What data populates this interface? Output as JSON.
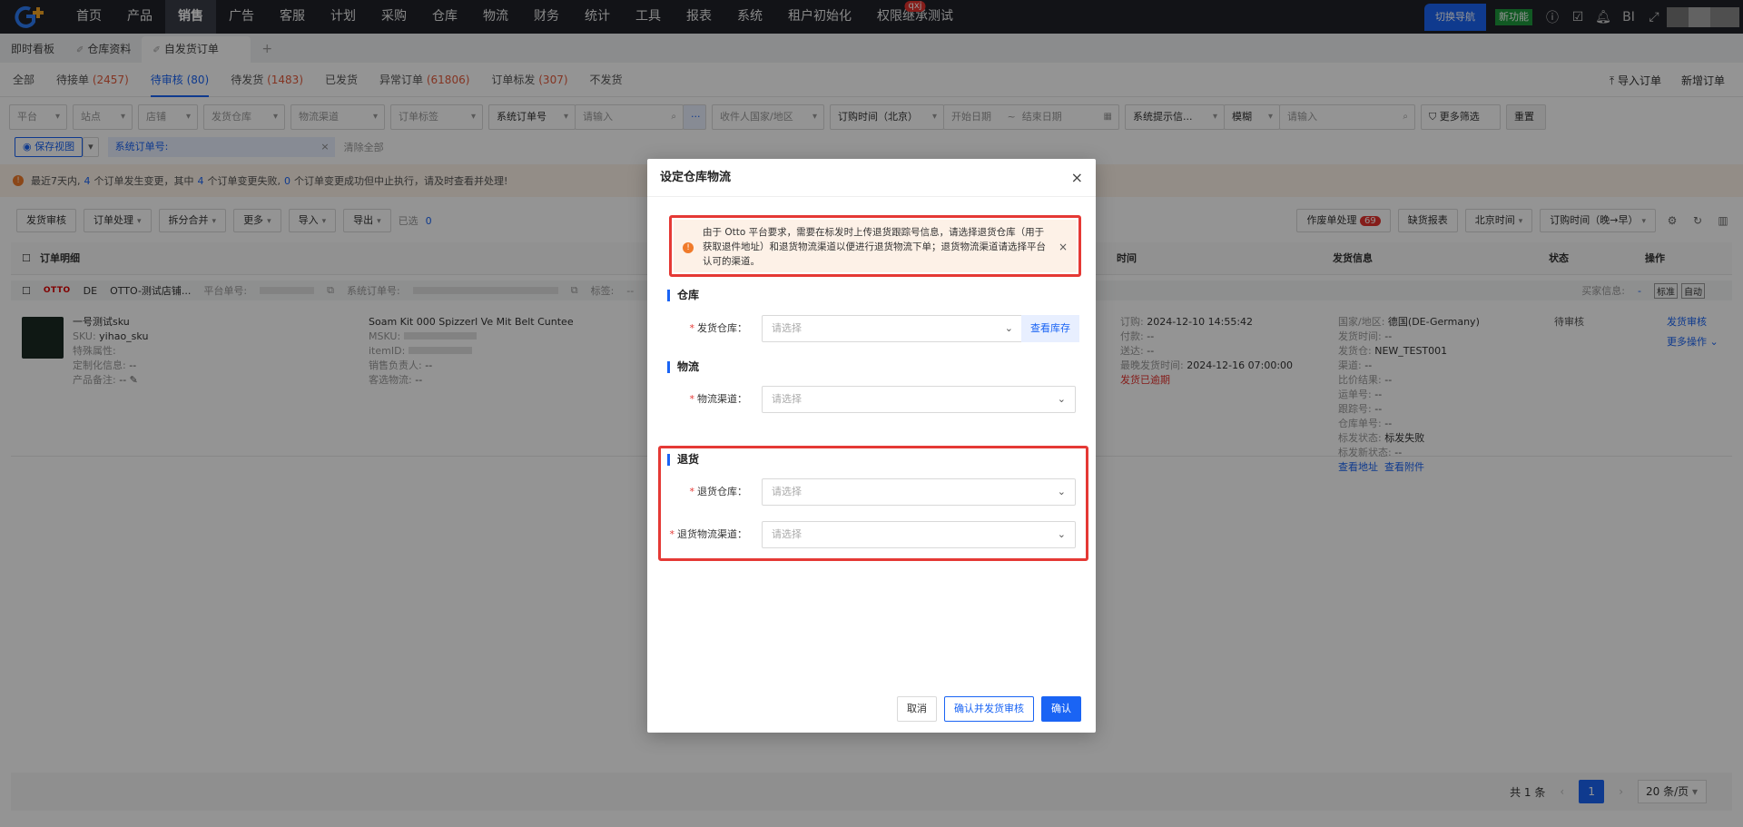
{
  "nav": {
    "logo": "G",
    "items": [
      "首页",
      "产品",
      "销售",
      "广告",
      "客服",
      "计划",
      "采购",
      "仓库",
      "物流",
      "财务",
      "统计",
      "工具",
      "报表",
      "系统",
      "租户初始化",
      "权限继承测试"
    ],
    "active": "销售",
    "badge": "qxj",
    "switch_nav": "切换导航",
    "new_func": "新功能",
    "bi": "BI"
  },
  "tabs": {
    "dashboard": "即时看板",
    "warehouse": "仓库资料",
    "current": "自发货订单",
    "add": "+"
  },
  "status_tabs": [
    {
      "label": "全部",
      "count": ""
    },
    {
      "label": "待接单",
      "count": "(2457)"
    },
    {
      "label": "待审核",
      "count": "(80)"
    },
    {
      "label": "待发货",
      "count": "(1483)"
    },
    {
      "label": "已发货",
      "count": ""
    },
    {
      "label": "异常订单",
      "count": "(61806)"
    },
    {
      "label": "订单标发",
      "count": "(307)"
    },
    {
      "label": "不发货",
      "count": ""
    }
  ],
  "top_actions": {
    "import": "导入订单",
    "new": "新增订单"
  },
  "filters": {
    "platform": "平台",
    "site": "站点",
    "store": "店铺",
    "ship_wh": "发货仓库",
    "channel": "物流渠道",
    "order_tag": "订单标签",
    "sys_order": "系统订单号",
    "input_ph": "请输入",
    "receiver_country": "收件人国家/地区",
    "order_time": "订购时间（北京）",
    "start_date": "开始日期",
    "date_sep": "~",
    "end_date": "结束日期",
    "sys_hint": "系统提示信...",
    "fuzzy": "模糊",
    "input_ph2": "请输入",
    "more_filter": "更多筛选",
    "reset": "重置"
  },
  "view_row": {
    "save_view": "保存视图",
    "chip": "系统订单号:",
    "clear_all": "清除全部"
  },
  "notice": {
    "p1": "最近7天内,",
    "n1": "4",
    "p2": "个订单发生变更，其中",
    "n2": "4",
    "p3": "个订单变更失败,",
    "n3": "0",
    "p4": "个订单变更成功但中止执行，请及时查看并处理!"
  },
  "toolbar": {
    "ship_review": "发货审核",
    "order_proc": "订单处理",
    "split_merge": "拆分合并",
    "more": "更多",
    "import": "导入",
    "export": "导出",
    "selected": "已选",
    "selected_count": "0",
    "void_proc": "作废单处理",
    "void_count": "69",
    "shortage": "缺货报表",
    "beijing": "北京时间",
    "sort": "订购时间（晚→早）"
  },
  "table": {
    "h_detail": "订单明细",
    "h_time": "时间",
    "h_ship": "发货信息",
    "h_status": "状态",
    "h_ops": "操作"
  },
  "group": {
    "platform_logo": "OTTO",
    "site": "DE",
    "store": "OTTO-测试店铺...",
    "platform_no": "平台单号:",
    "sys_no": "系统订单号:",
    "tag": "标签:",
    "tag_val": "--",
    "buyer": "买家信息:",
    "buyer_val": "-",
    "mark_flag": "标准",
    "mark_auto": "自动"
  },
  "row": {
    "name": "一号测试sku",
    "sku_l": "SKU:",
    "sku": "yihao_sku",
    "attr_l": "特殊属性:",
    "custom_l": "定制化信息:",
    "custom": "--",
    "remark_l": "产品备注:",
    "remark": "--",
    "title": "Soam Kit 000 Spizzerl Ve Mit Belt Cuntee",
    "msku_l": "MSKU:",
    "itemid_l": "itemID:",
    "sales_l": "销售负责人:",
    "sales": "--",
    "cust_l": "客选物流:",
    "cust": "--",
    "order_l": "订购:",
    "order_time": "2024-12-10 14:55:42",
    "pay_l": "付款:",
    "pay": "--",
    "deliver_l": "送达:",
    "deliver": "--",
    "latest_l": "最晚发货时间:",
    "latest": "2024-12-16 07:00:00",
    "overdue": "发货已逾期",
    "country_l": "国家/地区:",
    "country": "德国(DE-Germany)",
    "ship_time_l": "发货时间:",
    "ship_time": "--",
    "ship_wh_l": "发货仓:",
    "ship_wh": "NEW_TEST001",
    "channel_l": "渠道:",
    "channel": "--",
    "compare_l": "比价结果:",
    "compare": "--",
    "waybill_l": "运单号:",
    "waybill": "--",
    "tracking_l": "跟踪号:",
    "tracking": "--",
    "wh_order_l": "仓库单号:",
    "wh_order": "--",
    "mark_status_l": "标发状态:",
    "mark_status": "标发失败",
    "mark_new_l": "标发新状态:",
    "mark_new": "--",
    "view_addr": "查看地址",
    "view_attach": "查看附件",
    "status": "待审核",
    "op_ship": "发货审核",
    "op_more": "更多操作"
  },
  "pager": {
    "total": "共 1 条",
    "prev": "‹",
    "page": "1",
    "next": "›",
    "size": "20 条/页"
  },
  "modal": {
    "title": "设定仓库物流",
    "close": "×",
    "alert": "由于 Otto 平台要求，需要在标发时上传退货跟踪号信息，请选择退货仓库（用于获取退件地址）和退货物流渠道以便进行退货物流下单；退货物流渠道请选择平台认可的渠道。",
    "sec_wh": "仓库",
    "ship_wh_label": "发货仓库：",
    "sec_logi": "物流",
    "channel_label": "物流渠道：",
    "sec_return": "退货",
    "ret_wh_label": "退货仓库：",
    "ret_channel_label": "退货物流渠道：",
    "placeholder": "请选择",
    "view_stock": "查看库存",
    "cancel": "取消",
    "confirm_review": "确认并发货审核",
    "confirm": "确认"
  }
}
